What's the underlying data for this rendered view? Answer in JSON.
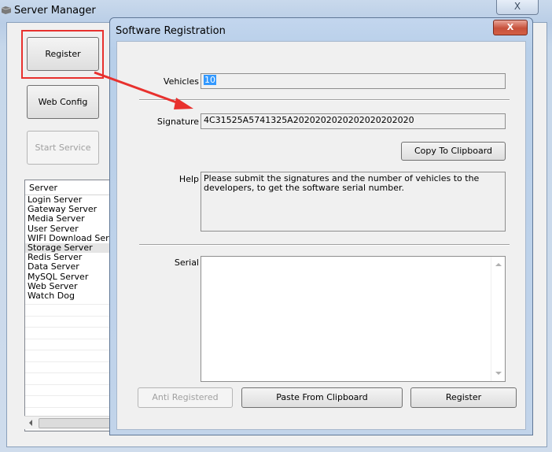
{
  "server_manager": {
    "title": "Server Manager",
    "buttons": {
      "register": "Register",
      "web_config": "Web Config",
      "start_service": "Start Service"
    },
    "list": {
      "header": "Server",
      "items": [
        "Login Server",
        "Gateway Server",
        "Media Server",
        "User Server",
        "WIFI Download Serv",
        "Storage Server",
        "Redis Server",
        "Data Server",
        "MySQL Server",
        "Web Server",
        "Watch Dog"
      ],
      "selected_index": 5
    },
    "close_glyph": "X"
  },
  "dialog": {
    "title": "Software Registration",
    "close_glyph": "X",
    "vehicles_label": "Vehicles",
    "vehicles_value": "10",
    "signature_label": "Signature",
    "signature_value": "4C31525A5741325A2020202020202020202020",
    "copy_button": "Copy To Clipboard",
    "help_label": "Help",
    "help_text": "Please submit the signatures and the number of vehicles to the developers, to get the software serial number.",
    "serial_label": "Serial",
    "serial_value": "",
    "buttons": {
      "anti_registered": "Anti Registered",
      "paste": "Paste From Clipboard",
      "register": "Register"
    }
  },
  "colors": {
    "highlight": "#e8312e",
    "selection": "#3399ff"
  }
}
